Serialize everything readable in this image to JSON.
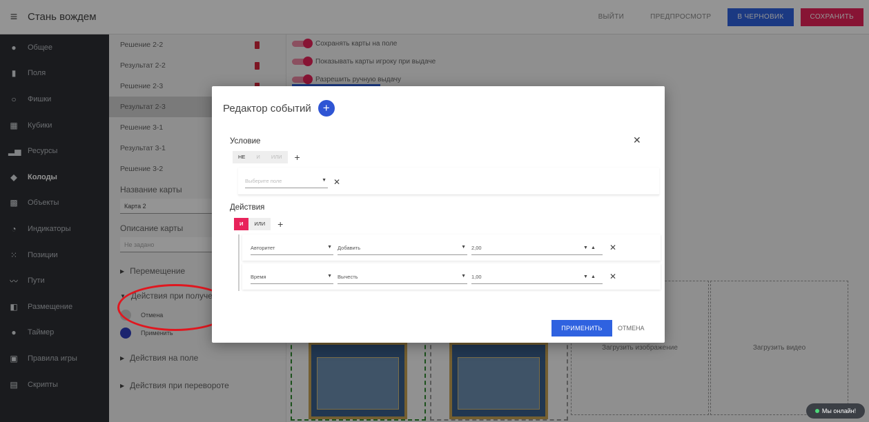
{
  "app": {
    "title": "Стань вождем"
  },
  "toolbar": {
    "exit": "ВЫЙТИ",
    "preview": "ПРЕДПРОСМОТР",
    "draft": "В ЧЕРНОВИК",
    "save": "СОХРАНИТЬ"
  },
  "nav": [
    {
      "label": "Общее",
      "icon": "info-icon"
    },
    {
      "label": "Поля",
      "icon": "board-icon"
    },
    {
      "label": "Фишки",
      "icon": "circle-icon"
    },
    {
      "label": "Кубики",
      "icon": "dice-icon"
    },
    {
      "label": "Ресурсы",
      "icon": "bar-chart-icon"
    },
    {
      "label": "Колоды",
      "icon": "layers-icon"
    },
    {
      "label": "Объекты",
      "icon": "grid-icon"
    },
    {
      "label": "Индикаторы",
      "icon": "gauge-icon"
    },
    {
      "label": "Позиции",
      "icon": "dots-grid-icon"
    },
    {
      "label": "Пути",
      "icon": "path-icon"
    },
    {
      "label": "Размещение",
      "icon": "placement-icon"
    },
    {
      "label": "Таймер",
      "icon": "timer-icon"
    },
    {
      "label": "Правила игры",
      "icon": "book-icon"
    },
    {
      "label": "Скрипты",
      "icon": "script-icon"
    }
  ],
  "list": {
    "items": [
      "Решение 2-2",
      "Результат 2-2",
      "Решение 2-3",
      "Результат 2-3",
      "Решение 3-1",
      "Результат 3-1",
      "Решение 3-2"
    ],
    "card_name_label": "Название карты",
    "card_name_value": "Карта 2",
    "card_desc_label": "Описание карты",
    "card_desc_value": "Не задано",
    "section_move": "Перемещение",
    "section_receive": "Действия при получении",
    "radio_cancel": "Отмена",
    "radio_apply": "Применить",
    "section_field": "Действия на поле",
    "section_flip": "Действия при перевороте"
  },
  "workspace": {
    "toggles": [
      "Сохранять карты на поле",
      "Показывать карты игроку при выдаче",
      "Разрешить ручную выдачу"
    ],
    "upload_image": "Загрузить изображение",
    "upload_video": "Загрузить видео"
  },
  "modal": {
    "title": "Редактор событий",
    "condition_label": "Условие",
    "cond_not": "НЕ",
    "cond_and": "И",
    "cond_or": "ИЛИ",
    "cond_select_placeholder": "Выберите поле",
    "actions_label": "Действия",
    "act_and": "И",
    "act_or": "ИЛИ",
    "rows": [
      {
        "target": "Авторитет",
        "op": "Добавить",
        "value": "2,00"
      },
      {
        "target": "Время",
        "op": "Вычесть",
        "value": "1,00"
      }
    ],
    "apply": "ПРИМЕНИТЬ",
    "cancel": "ОТМЕНА"
  },
  "chat": {
    "label": "Мы онлайн!"
  },
  "colors": {
    "accent_blue": "#2f62e0",
    "accent_red": "#e8235b",
    "nav_bg": "#2d3035"
  }
}
